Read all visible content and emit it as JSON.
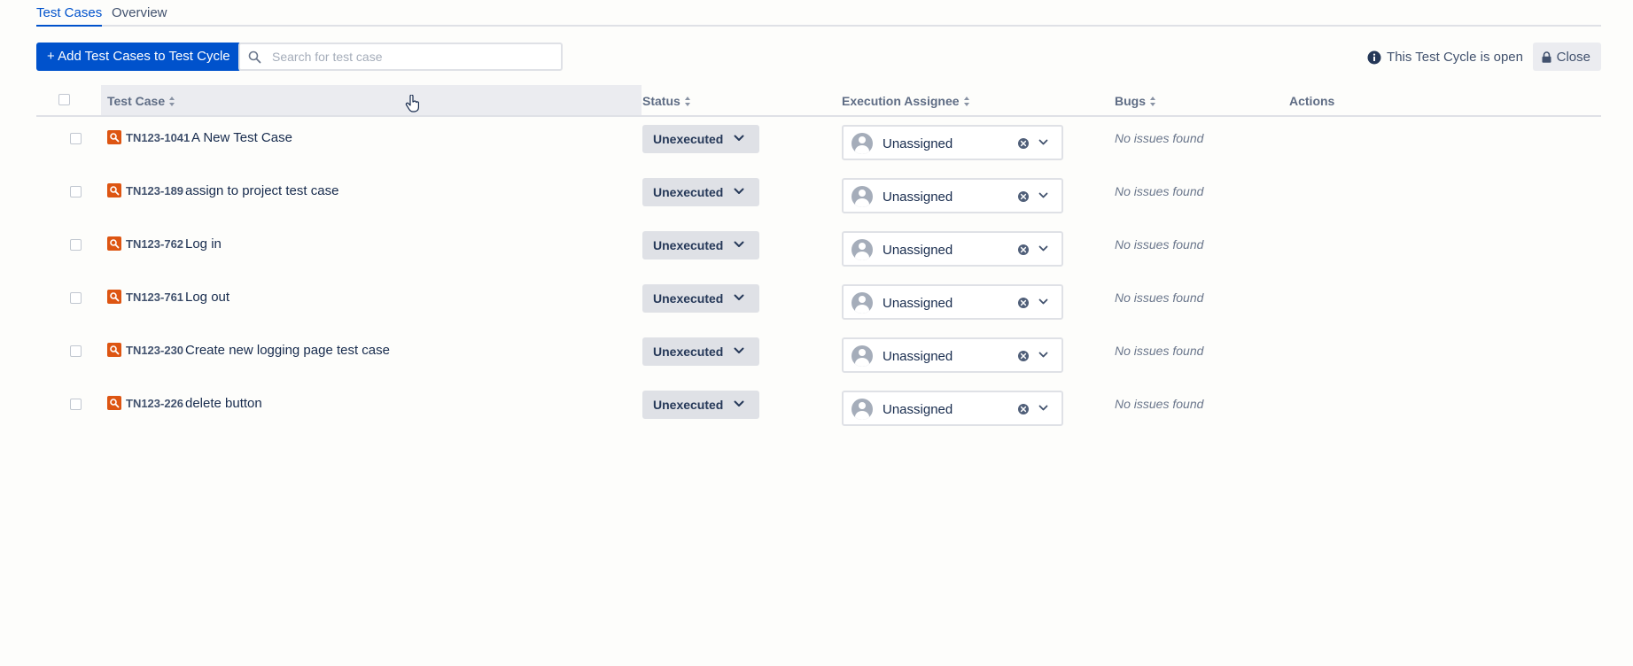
{
  "tabs": [
    {
      "label": "Test Cases",
      "active": true
    },
    {
      "label": "Overview",
      "active": false
    }
  ],
  "toolbar": {
    "add_label": "+ Add Test Cases to Test Cycle",
    "search_placeholder": "Search for test case",
    "cycle_status": "This Test Cycle is open",
    "close_label": "Close"
  },
  "table": {
    "columns": {
      "test_case": "Test Case",
      "status": "Status",
      "assignee": "Execution Assignee",
      "bugs": "Bugs",
      "actions": "Actions"
    },
    "rows": [
      {
        "key": "TN123-1041",
        "name": "A New Test Case",
        "status": "Unexecuted",
        "assignee": "Unassigned",
        "bugs": "No issues found"
      },
      {
        "key": "TN123-189",
        "name": "assign to project test case",
        "status": "Unexecuted",
        "assignee": "Unassigned",
        "bugs": "No issues found"
      },
      {
        "key": "TN123-762",
        "name": "Log in",
        "status": "Unexecuted",
        "assignee": "Unassigned",
        "bugs": "No issues found"
      },
      {
        "key": "TN123-761",
        "name": "Log out",
        "status": "Unexecuted",
        "assignee": "Unassigned",
        "bugs": "No issues found"
      },
      {
        "key": "TN123-230",
        "name": "Create new logging page test case",
        "status": "Unexecuted",
        "assignee": "Unassigned",
        "bugs": "No issues found"
      },
      {
        "key": "TN123-226",
        "name": "delete button",
        "status": "Unexecuted",
        "assignee": "Unassigned",
        "bugs": "No issues found"
      }
    ]
  },
  "colors": {
    "primary": "#0052cc",
    "test_case_icon": "#dd5512",
    "status_bg": "#dfe1e6"
  },
  "icons": {
    "search": "search-icon",
    "info": "info-icon",
    "lock": "lock-icon",
    "test_case": "test-case-icon",
    "avatar": "user-avatar-icon",
    "clear": "clear-icon",
    "chevron": "chevron-down-icon"
  }
}
